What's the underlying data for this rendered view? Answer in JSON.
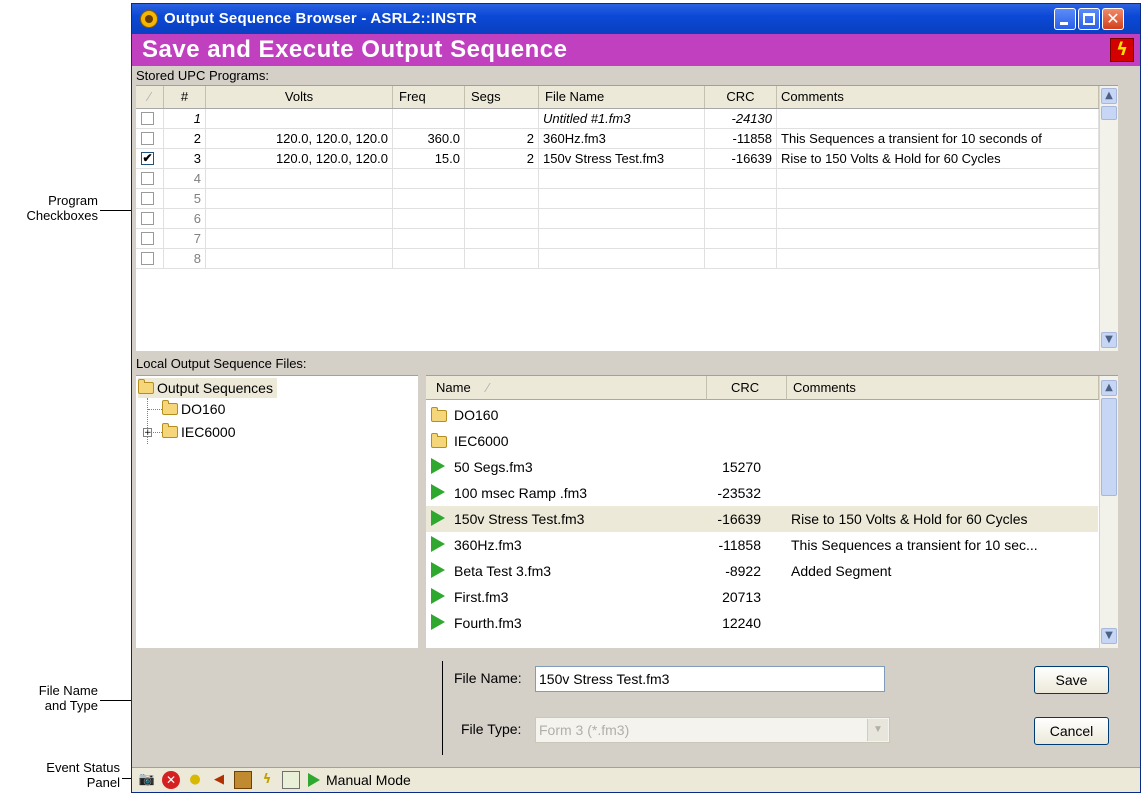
{
  "callouts": {
    "program_checkboxes": "Program\nCheckboxes",
    "file_name_type": "File Name\nand Type",
    "event_status": "Event Status\nPanel"
  },
  "window": {
    "title": "Output Sequence Browser - ASRL2::INSTR",
    "banner": "Save and Execute Output Sequence"
  },
  "stored": {
    "label": "Stored UPC Programs:",
    "columns": [
      "#",
      "Volts",
      "Freq",
      "Segs",
      "File Name",
      "CRC",
      "Comments"
    ],
    "rows": [
      {
        "checked": false,
        "num": "1",
        "volts": "",
        "freq": "",
        "segs": "",
        "file": "Untitled #1.fm3",
        "crc": "-24130",
        "comment": "",
        "style": "italic"
      },
      {
        "checked": false,
        "num": "2",
        "volts": "120.0, 120.0, 120.0",
        "freq": "360.0",
        "segs": "2",
        "file": "360Hz.fm3",
        "crc": "-11858",
        "comment": "This Sequences a transient for 10 seconds of",
        "style": ""
      },
      {
        "checked": true,
        "num": "3",
        "volts": "120.0, 120.0, 120.0",
        "freq": "15.0",
        "segs": "2",
        "file": "150v Stress Test.fm3",
        "crc": "-16639",
        "comment": "Rise to 150 Volts & Hold for 60 Cycles",
        "style": ""
      },
      {
        "checked": false,
        "num": "4",
        "volts": "",
        "freq": "",
        "segs": "",
        "file": "",
        "crc": "",
        "comment": "",
        "style": "dim"
      },
      {
        "checked": false,
        "num": "5",
        "volts": "",
        "freq": "",
        "segs": "",
        "file": "",
        "crc": "",
        "comment": "",
        "style": "dim"
      },
      {
        "checked": false,
        "num": "6",
        "volts": "",
        "freq": "",
        "segs": "",
        "file": "",
        "crc": "",
        "comment": "",
        "style": "dim"
      },
      {
        "checked": false,
        "num": "7",
        "volts": "",
        "freq": "",
        "segs": "",
        "file": "",
        "crc": "",
        "comment": "",
        "style": "dim"
      },
      {
        "checked": false,
        "num": "8",
        "volts": "",
        "freq": "",
        "segs": "",
        "file": "",
        "crc": "",
        "comment": "",
        "style": "dim"
      }
    ]
  },
  "local": {
    "label": "Local Output Sequence Files:",
    "tree": {
      "root": "Output Sequences",
      "children": [
        "DO160",
        "IEC6000"
      ]
    },
    "columns": [
      "Name",
      "CRC",
      "Comments"
    ],
    "files": [
      {
        "kind": "folder",
        "name": "DO160",
        "crc": "",
        "comment": ""
      },
      {
        "kind": "folder",
        "name": "IEC6000",
        "crc": "",
        "comment": ""
      },
      {
        "kind": "file",
        "name": "50 Segs.fm3",
        "crc": "15270",
        "comment": ""
      },
      {
        "kind": "file",
        "name": "100 msec Ramp .fm3",
        "crc": "-23532",
        "comment": ""
      },
      {
        "kind": "file",
        "name": "150v Stress Test.fm3",
        "crc": "-16639",
        "comment": "Rise to 150 Volts & Hold for 60 Cycles",
        "selected": true
      },
      {
        "kind": "file",
        "name": "360Hz.fm3",
        "crc": "-11858",
        "comment": "This Sequences a transient for 10 sec..."
      },
      {
        "kind": "file",
        "name": "Beta Test 3.fm3",
        "crc": "-8922",
        "comment": "Added Segment"
      },
      {
        "kind": "file",
        "name": "First.fm3",
        "crc": "20713",
        "comment": ""
      },
      {
        "kind": "file",
        "name": "Fourth.fm3",
        "crc": "12240",
        "comment": ""
      }
    ]
  },
  "form": {
    "file_name_label": "File Name:",
    "file_name_value": "150v Stress Test.fm3",
    "file_type_label": "File Type:",
    "file_type_value": "Form 3 (*.fm3)",
    "save": "Save",
    "cancel": "Cancel"
  },
  "status": {
    "icons": [
      "camera-icon",
      "error-icon",
      "bulb-icon",
      "speaker-icon",
      "chip-icon",
      "bolt-icon",
      "display-icon"
    ],
    "mode": "Manual Mode"
  }
}
